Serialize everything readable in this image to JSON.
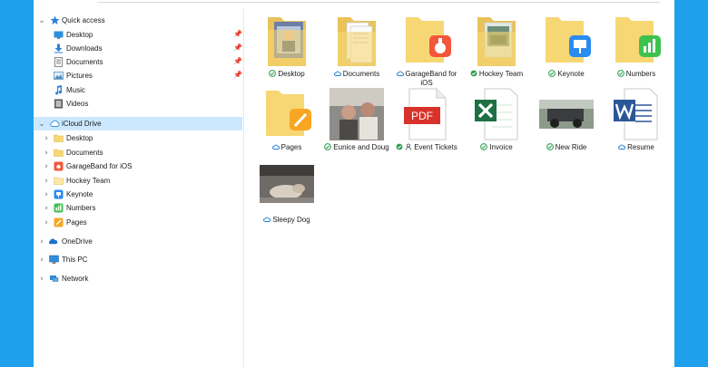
{
  "colors": {
    "background": "#1ea0ec",
    "selection": "#cce8ff",
    "folder": "#f7d774",
    "synced": "#2e9e4f",
    "cloud": "#1e7fd4"
  },
  "nav": {
    "quick_access": "Quick access",
    "quick_items": [
      {
        "label": "Desktop",
        "icon": "desktop-icon",
        "pinned": true
      },
      {
        "label": "Downloads",
        "icon": "download-icon",
        "pinned": true
      },
      {
        "label": "Documents",
        "icon": "document-icon",
        "pinned": true
      },
      {
        "label": "Pictures",
        "icon": "pictures-icon",
        "pinned": true
      },
      {
        "label": "Music",
        "icon": "music-icon",
        "pinned": false
      },
      {
        "label": "Videos",
        "icon": "videos-icon",
        "pinned": false
      }
    ],
    "icloud": "iCloud Drive",
    "icloud_items": [
      {
        "label": "Desktop",
        "icon": "folder-icon"
      },
      {
        "label": "Documents",
        "icon": "folder-icon"
      },
      {
        "label": "GarageBand for iOS",
        "icon": "garageband-icon"
      },
      {
        "label": "Hockey Team",
        "icon": "folder-icon"
      },
      {
        "label": "Keynote",
        "icon": "keynote-icon"
      },
      {
        "label": "Numbers",
        "icon": "numbers-icon"
      },
      {
        "label": "Pages",
        "icon": "pages-icon"
      }
    ],
    "onedrive": "OneDrive",
    "thispc": "This PC",
    "network": "Network"
  },
  "files": [
    {
      "name": "Desktop",
      "kind": "folder-photo",
      "status": "synced"
    },
    {
      "name": "Documents",
      "kind": "folder-docs",
      "status": "cloud"
    },
    {
      "name": "GarageBand for iOS",
      "kind": "folder-garageband",
      "status": "cloud"
    },
    {
      "name": "Hockey Team",
      "kind": "folder-photo2",
      "status": "synced"
    },
    {
      "name": "Keynote",
      "kind": "folder-keynote",
      "status": "synced"
    },
    {
      "name": "Numbers",
      "kind": "folder-numbers",
      "status": "synced"
    },
    {
      "name": "Pages",
      "kind": "folder-pages",
      "status": "cloud"
    },
    {
      "name": "Eunice and Doug",
      "kind": "photo-car",
      "status": "synced"
    },
    {
      "name": "Event Tickets",
      "kind": "pdf",
      "status": "shared",
      "badge": "PDF"
    },
    {
      "name": "Invoice",
      "kind": "excel",
      "status": "synced"
    },
    {
      "name": "New Ride",
      "kind": "photo-jeep",
      "status": "synced"
    },
    {
      "name": "Resume",
      "kind": "word",
      "status": "cloud"
    },
    {
      "name": "Sleepy Dog",
      "kind": "photo-dog",
      "status": "cloud"
    }
  ]
}
